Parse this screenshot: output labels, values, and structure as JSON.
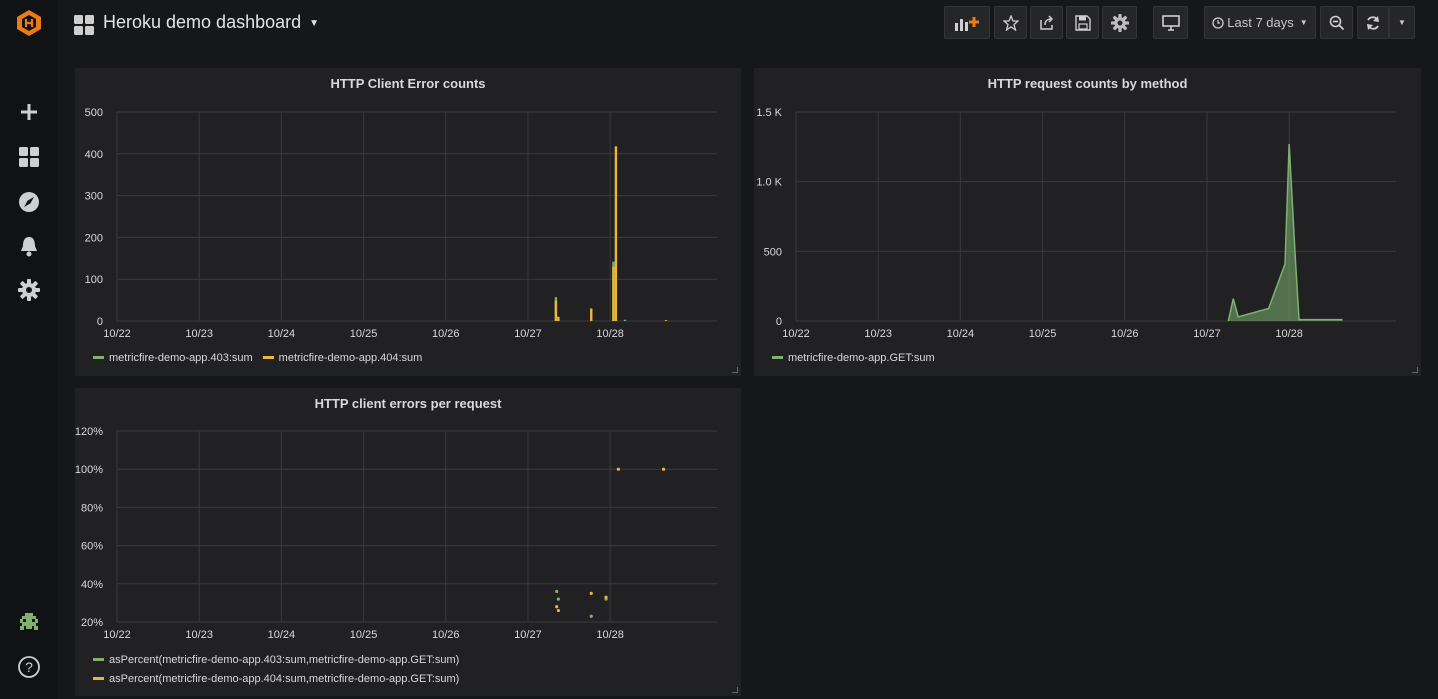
{
  "app": {
    "dashboard_title": "Heroku demo dashboard",
    "colors": {
      "accent": "#eb7b18",
      "green": "#7eb26d",
      "yellow": "#eab839",
      "panel_bg": "#212124",
      "page_bg": "#161719",
      "grid": "#3a3a3d"
    }
  },
  "sidebar": {
    "items": [
      {
        "name": "grafana-logo-icon"
      },
      {
        "name": "plus-icon"
      },
      {
        "name": "dashboards-icon"
      },
      {
        "name": "explore-compass-icon"
      },
      {
        "name": "alerting-bell-icon"
      },
      {
        "name": "configuration-gear-icon"
      },
      {
        "name": "user-avatar-icon"
      },
      {
        "name": "help-icon",
        "label": "?"
      }
    ]
  },
  "toolbar": {
    "add_panel_icon": "bar-chart-plus-icon",
    "star_icon": "star-icon",
    "share_icon": "share-icon",
    "save_icon": "save-icon",
    "settings_icon": "gear-icon",
    "tv_icon": "monitor-icon",
    "time_range_label": "Last 7 days",
    "zoom_icon": "zoom-out-icon",
    "refresh_icon": "refresh-icon"
  },
  "panels": {
    "p1": {
      "title": "HTTP Client Error counts"
    },
    "p2": {
      "title": "HTTP request counts by method"
    },
    "p3": {
      "title": "HTTP client errors per request"
    }
  },
  "chart_data": [
    {
      "type": "bar",
      "title": "HTTP Client Error counts",
      "x_ticks": [
        "10/22",
        "10/23",
        "10/24",
        "10/25",
        "10/26",
        "10/27",
        "10/28"
      ],
      "y_ticks": [
        "0",
        "100",
        "200",
        "300",
        "400",
        "500"
      ],
      "ylim": [
        0,
        500
      ],
      "xlim": [
        0,
        7.3
      ],
      "series": [
        {
          "name": "metricfire-demo-app.403:sum",
          "color": "#7eb26d",
          "points": [
            [
              5.34,
              57
            ],
            [
              6.04,
              142
            ],
            [
              6.18,
              3
            ]
          ]
        },
        {
          "name": "metricfire-demo-app.404:sum",
          "color": "#eab839",
          "points": [
            [
              5.34,
              48
            ],
            [
              5.37,
              10
            ],
            [
              5.77,
              30
            ],
            [
              6.04,
              130
            ],
            [
              6.07,
              418
            ],
            [
              6.68,
              2
            ]
          ]
        }
      ],
      "legend": "bottom-left"
    },
    {
      "type": "area",
      "title": "HTTP request counts by method",
      "x_ticks": [
        "10/22",
        "10/23",
        "10/24",
        "10/25",
        "10/26",
        "10/27",
        "10/28"
      ],
      "y_ticks": [
        "0",
        "500",
        "1.0 K",
        "1.5 K"
      ],
      "ylim": [
        0,
        1500
      ],
      "xlim": [
        0,
        7.3
      ],
      "series": [
        {
          "name": "metricfire-demo-app.GET:sum",
          "color": "#7eb26d",
          "points": [
            [
              5.26,
              0
            ],
            [
              5.32,
              160
            ],
            [
              5.38,
              30
            ],
            [
              5.75,
              90
            ],
            [
              5.95,
              410
            ],
            [
              6.0,
              1270
            ],
            [
              6.08,
              400
            ],
            [
              6.12,
              10
            ],
            [
              6.65,
              10
            ]
          ]
        }
      ],
      "legend": "bottom-left"
    },
    {
      "type": "scatter",
      "title": "HTTP client errors per request",
      "x_ticks": [
        "10/22",
        "10/23",
        "10/24",
        "10/25",
        "10/26",
        "10/27",
        "10/28"
      ],
      "y_ticks": [
        "20%",
        "40%",
        "60%",
        "80%",
        "100%",
        "120%"
      ],
      "ylim": [
        20,
        120
      ],
      "xlim": [
        0,
        7.3
      ],
      "series": [
        {
          "name": "asPercent(metricfire-demo-app.403:sum,metricfire-demo-app.GET:sum)",
          "color": "#7eb26d",
          "points": [
            [
              5.35,
              36
            ],
            [
              5.37,
              32
            ],
            [
              5.77,
              23
            ],
            [
              5.95,
              32
            ]
          ]
        },
        {
          "name": "asPercent(metricfire-demo-app.404:sum,metricfire-demo-app.GET:sum)",
          "color": "#eab839",
          "points": [
            [
              5.35,
              28
            ],
            [
              5.37,
              26
            ],
            [
              5.77,
              35
            ],
            [
              5.95,
              33
            ],
            [
              6.1,
              100
            ],
            [
              6.65,
              100
            ]
          ]
        }
      ],
      "legend": "bottom-left"
    }
  ]
}
